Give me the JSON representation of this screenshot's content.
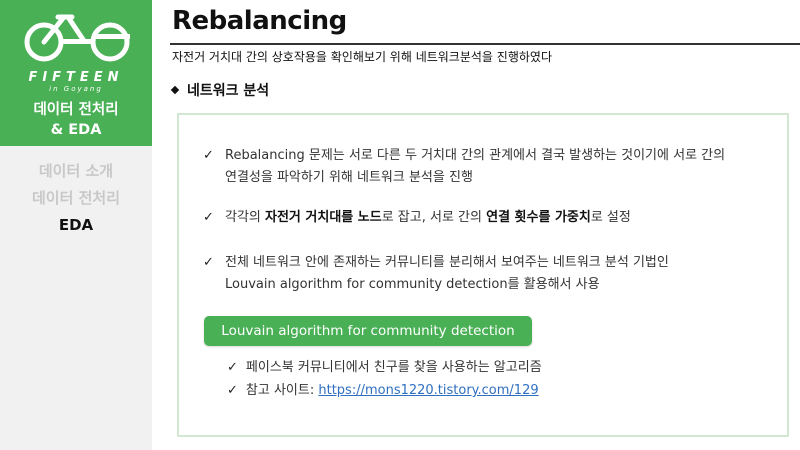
{
  "sidebar": {
    "logo": {
      "wordmark": "FIFTEEN",
      "subline": "in Goyang"
    },
    "section_title_line1": "데이터 전처리",
    "section_title_line2": "& EDA",
    "nav": [
      {
        "label": "데이터 소개",
        "active": false
      },
      {
        "label": "데이터 전처리",
        "active": false
      },
      {
        "label": "EDA",
        "active": true
      }
    ]
  },
  "header": {
    "title": "Rebalancing",
    "subtitle": "자전거 거치대 간의 상호작용을 확인해보기 위해 네트워크분석을 진행하였다"
  },
  "section": {
    "heading": "네트워크 분석"
  },
  "bullets": {
    "b1_line1": "Rebalancing 문제는 서로 다른 두 거치대 간의 관계에서 결국 발생하는 것이기에 서로 간의",
    "b1_line2": "연결성을 파악하기 위해 네트워크 분석을 진행",
    "b2_prefix": "각각의 ",
    "b2_bold1": "자전거 거치대를 노드",
    "b2_mid": "로 잡고, 서로 간의 ",
    "b2_bold2": "연결 횟수를 가중치",
    "b2_suffix": "로 설정",
    "b3_line1": "전체 네트워크 안에 존재하는 커뮤니티를 분리해서 보여주는 네트워크 분석 기법인",
    "b3_line2": "Louvain algorithm for community detection를 활용해서 사용"
  },
  "pill": {
    "label": "Louvain algorithm for community detection"
  },
  "sub_bullets": {
    "s1": "페이스북 커뮤니티에서 친구를 찾을 사용하는 알고리즘",
    "s2_prefix": "참고 사이트: ",
    "s2_link": "https://mons1220.tistory.com/129"
  },
  "glyphs": {
    "check": "✓"
  },
  "colors": {
    "brand_green": "#4ab056",
    "box_border": "#d3e8d3",
    "link": "#2f6fc1",
    "inactive_nav": "#c8c8c8"
  }
}
